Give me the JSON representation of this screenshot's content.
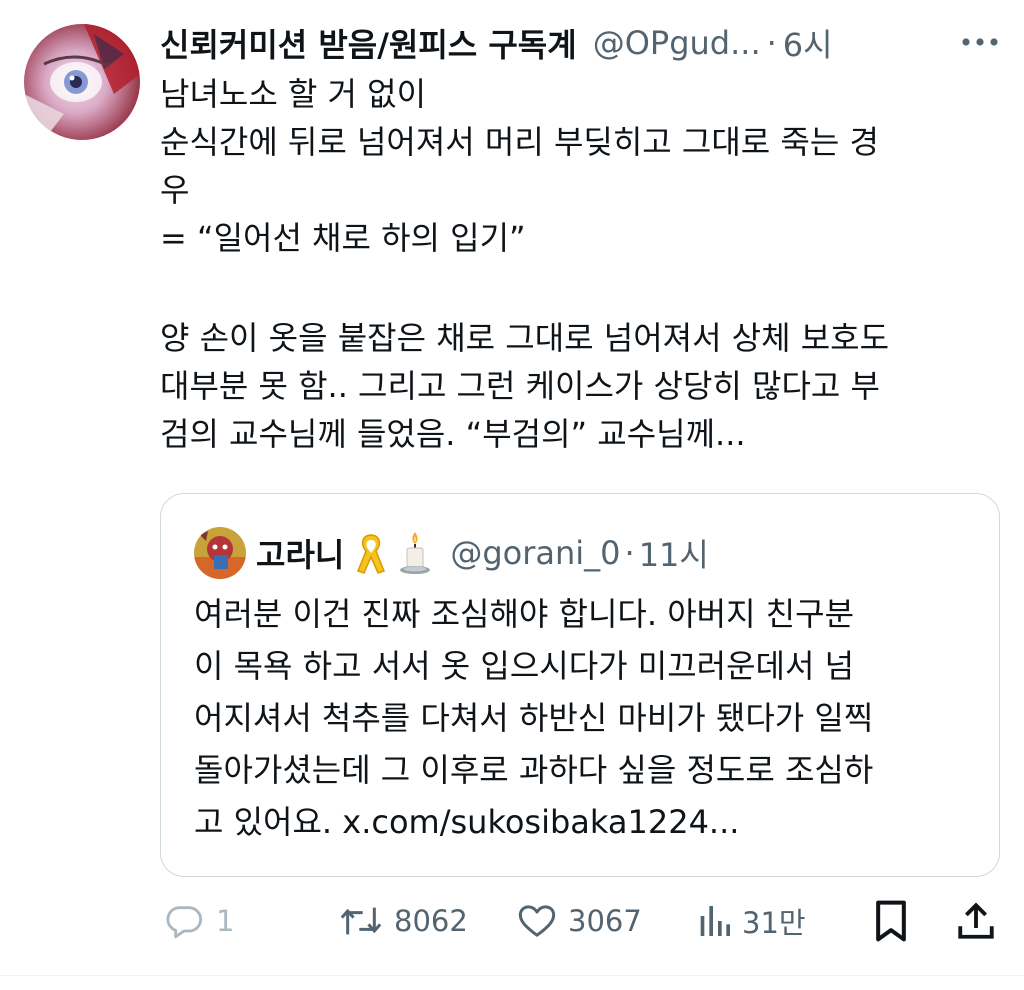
{
  "tweet": {
    "author": {
      "display_name": "신뢰커미션 받음/원피스 구독계",
      "handle": "@OPgud...",
      "separator": "·",
      "time": "6시"
    },
    "more_icon": "more-horizontal-icon",
    "body_lines_1": [
      "남녀노소 할 거 없이",
      "순식간에 뒤로 넘어져서 머리 부딪히고 그대로 죽는 경",
      "우",
      "= “일어선 채로 하의 입기”"
    ],
    "body_lines_2": [
      "양 손이 옷을 붙잡은 채로 그대로 넘어져서 상체 보호도",
      "대부분 못 함.. 그리고 그런 케이스가 상당히 많다고 부",
      "검의 교수님께 들었음. “부검의” 교수님께..."
    ]
  },
  "quote": {
    "display_name": "고라니",
    "emojis": [
      "yellow-ribbon-icon",
      "candle-icon"
    ],
    "handle": "@gorani_0",
    "separator": "·",
    "time": "11시",
    "lines": [
      "여러분 이건 진짜 조심해야 합니다. 아버지 친구분",
      "이 목욕 하고 서서 옷 입으시다가 미끄러운데서 넘",
      "어지셔서 척추를 다쳐서 하반신 마비가 됐다가 일찍",
      "돌아가셨는데 그 이후로 과하다 싶을 정도로 조심하",
      "고 있어요. x.com/sukosibaka1224..."
    ]
  },
  "actions": {
    "reply": {
      "icon": "reply-icon",
      "count": "1"
    },
    "retweet": {
      "icon": "retweet-icon",
      "count": "8062"
    },
    "like": {
      "icon": "heart-icon",
      "count": "3067"
    },
    "views": {
      "icon": "views-icon",
      "count": "31만"
    },
    "bookmark": {
      "icon": "bookmark-icon"
    },
    "share": {
      "icon": "share-icon"
    }
  },
  "colors": {
    "text": "#0f1419",
    "secondary": "#536471",
    "border": "#cfd9de",
    "muted": "#aab8c2"
  }
}
